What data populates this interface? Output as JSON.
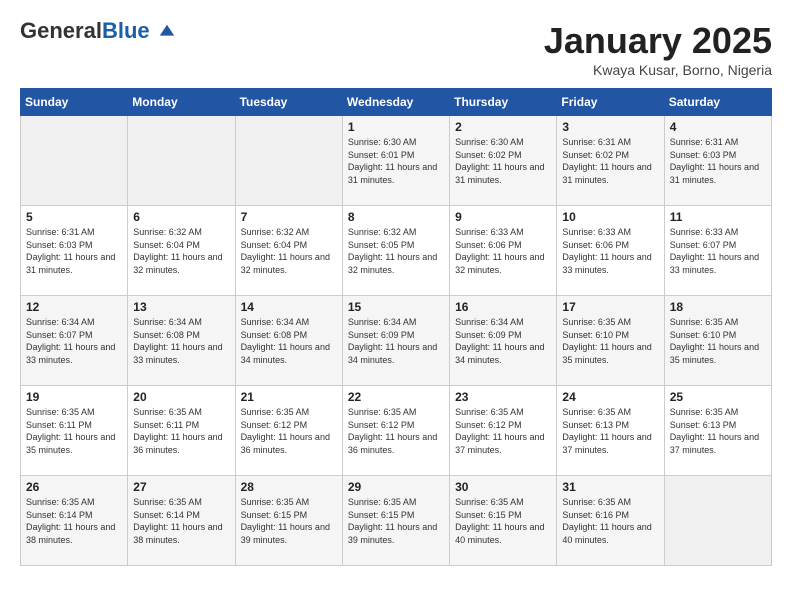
{
  "header": {
    "logo_general": "General",
    "logo_blue": "Blue",
    "month_title": "January 2025",
    "location": "Kwaya Kusar, Borno, Nigeria"
  },
  "days_of_week": [
    "Sunday",
    "Monday",
    "Tuesday",
    "Wednesday",
    "Thursday",
    "Friday",
    "Saturday"
  ],
  "weeks": [
    [
      {
        "day": "",
        "sunrise": "",
        "sunset": "",
        "daylight": ""
      },
      {
        "day": "",
        "sunrise": "",
        "sunset": "",
        "daylight": ""
      },
      {
        "day": "",
        "sunrise": "",
        "sunset": "",
        "daylight": ""
      },
      {
        "day": "1",
        "sunrise": "Sunrise: 6:30 AM",
        "sunset": "Sunset: 6:01 PM",
        "daylight": "Daylight: 11 hours and 31 minutes."
      },
      {
        "day": "2",
        "sunrise": "Sunrise: 6:30 AM",
        "sunset": "Sunset: 6:02 PM",
        "daylight": "Daylight: 11 hours and 31 minutes."
      },
      {
        "day": "3",
        "sunrise": "Sunrise: 6:31 AM",
        "sunset": "Sunset: 6:02 PM",
        "daylight": "Daylight: 11 hours and 31 minutes."
      },
      {
        "day": "4",
        "sunrise": "Sunrise: 6:31 AM",
        "sunset": "Sunset: 6:03 PM",
        "daylight": "Daylight: 11 hours and 31 minutes."
      }
    ],
    [
      {
        "day": "5",
        "sunrise": "Sunrise: 6:31 AM",
        "sunset": "Sunset: 6:03 PM",
        "daylight": "Daylight: 11 hours and 31 minutes."
      },
      {
        "day": "6",
        "sunrise": "Sunrise: 6:32 AM",
        "sunset": "Sunset: 6:04 PM",
        "daylight": "Daylight: 11 hours and 32 minutes."
      },
      {
        "day": "7",
        "sunrise": "Sunrise: 6:32 AM",
        "sunset": "Sunset: 6:04 PM",
        "daylight": "Daylight: 11 hours and 32 minutes."
      },
      {
        "day": "8",
        "sunrise": "Sunrise: 6:32 AM",
        "sunset": "Sunset: 6:05 PM",
        "daylight": "Daylight: 11 hours and 32 minutes."
      },
      {
        "day": "9",
        "sunrise": "Sunrise: 6:33 AM",
        "sunset": "Sunset: 6:06 PM",
        "daylight": "Daylight: 11 hours and 32 minutes."
      },
      {
        "day": "10",
        "sunrise": "Sunrise: 6:33 AM",
        "sunset": "Sunset: 6:06 PM",
        "daylight": "Daylight: 11 hours and 33 minutes."
      },
      {
        "day": "11",
        "sunrise": "Sunrise: 6:33 AM",
        "sunset": "Sunset: 6:07 PM",
        "daylight": "Daylight: 11 hours and 33 minutes."
      }
    ],
    [
      {
        "day": "12",
        "sunrise": "Sunrise: 6:34 AM",
        "sunset": "Sunset: 6:07 PM",
        "daylight": "Daylight: 11 hours and 33 minutes."
      },
      {
        "day": "13",
        "sunrise": "Sunrise: 6:34 AM",
        "sunset": "Sunset: 6:08 PM",
        "daylight": "Daylight: 11 hours and 33 minutes."
      },
      {
        "day": "14",
        "sunrise": "Sunrise: 6:34 AM",
        "sunset": "Sunset: 6:08 PM",
        "daylight": "Daylight: 11 hours and 34 minutes."
      },
      {
        "day": "15",
        "sunrise": "Sunrise: 6:34 AM",
        "sunset": "Sunset: 6:09 PM",
        "daylight": "Daylight: 11 hours and 34 minutes."
      },
      {
        "day": "16",
        "sunrise": "Sunrise: 6:34 AM",
        "sunset": "Sunset: 6:09 PM",
        "daylight": "Daylight: 11 hours and 34 minutes."
      },
      {
        "day": "17",
        "sunrise": "Sunrise: 6:35 AM",
        "sunset": "Sunset: 6:10 PM",
        "daylight": "Daylight: 11 hours and 35 minutes."
      },
      {
        "day": "18",
        "sunrise": "Sunrise: 6:35 AM",
        "sunset": "Sunset: 6:10 PM",
        "daylight": "Daylight: 11 hours and 35 minutes."
      }
    ],
    [
      {
        "day": "19",
        "sunrise": "Sunrise: 6:35 AM",
        "sunset": "Sunset: 6:11 PM",
        "daylight": "Daylight: 11 hours and 35 minutes."
      },
      {
        "day": "20",
        "sunrise": "Sunrise: 6:35 AM",
        "sunset": "Sunset: 6:11 PM",
        "daylight": "Daylight: 11 hours and 36 minutes."
      },
      {
        "day": "21",
        "sunrise": "Sunrise: 6:35 AM",
        "sunset": "Sunset: 6:12 PM",
        "daylight": "Daylight: 11 hours and 36 minutes."
      },
      {
        "day": "22",
        "sunrise": "Sunrise: 6:35 AM",
        "sunset": "Sunset: 6:12 PM",
        "daylight": "Daylight: 11 hours and 36 minutes."
      },
      {
        "day": "23",
        "sunrise": "Sunrise: 6:35 AM",
        "sunset": "Sunset: 6:12 PM",
        "daylight": "Daylight: 11 hours and 37 minutes."
      },
      {
        "day": "24",
        "sunrise": "Sunrise: 6:35 AM",
        "sunset": "Sunset: 6:13 PM",
        "daylight": "Daylight: 11 hours and 37 minutes."
      },
      {
        "day": "25",
        "sunrise": "Sunrise: 6:35 AM",
        "sunset": "Sunset: 6:13 PM",
        "daylight": "Daylight: 11 hours and 37 minutes."
      }
    ],
    [
      {
        "day": "26",
        "sunrise": "Sunrise: 6:35 AM",
        "sunset": "Sunset: 6:14 PM",
        "daylight": "Daylight: 11 hours and 38 minutes."
      },
      {
        "day": "27",
        "sunrise": "Sunrise: 6:35 AM",
        "sunset": "Sunset: 6:14 PM",
        "daylight": "Daylight: 11 hours and 38 minutes."
      },
      {
        "day": "28",
        "sunrise": "Sunrise: 6:35 AM",
        "sunset": "Sunset: 6:15 PM",
        "daylight": "Daylight: 11 hours and 39 minutes."
      },
      {
        "day": "29",
        "sunrise": "Sunrise: 6:35 AM",
        "sunset": "Sunset: 6:15 PM",
        "daylight": "Daylight: 11 hours and 39 minutes."
      },
      {
        "day": "30",
        "sunrise": "Sunrise: 6:35 AM",
        "sunset": "Sunset: 6:15 PM",
        "daylight": "Daylight: 11 hours and 40 minutes."
      },
      {
        "day": "31",
        "sunrise": "Sunrise: 6:35 AM",
        "sunset": "Sunset: 6:16 PM",
        "daylight": "Daylight: 11 hours and 40 minutes."
      },
      {
        "day": "",
        "sunrise": "",
        "sunset": "",
        "daylight": ""
      }
    ]
  ]
}
